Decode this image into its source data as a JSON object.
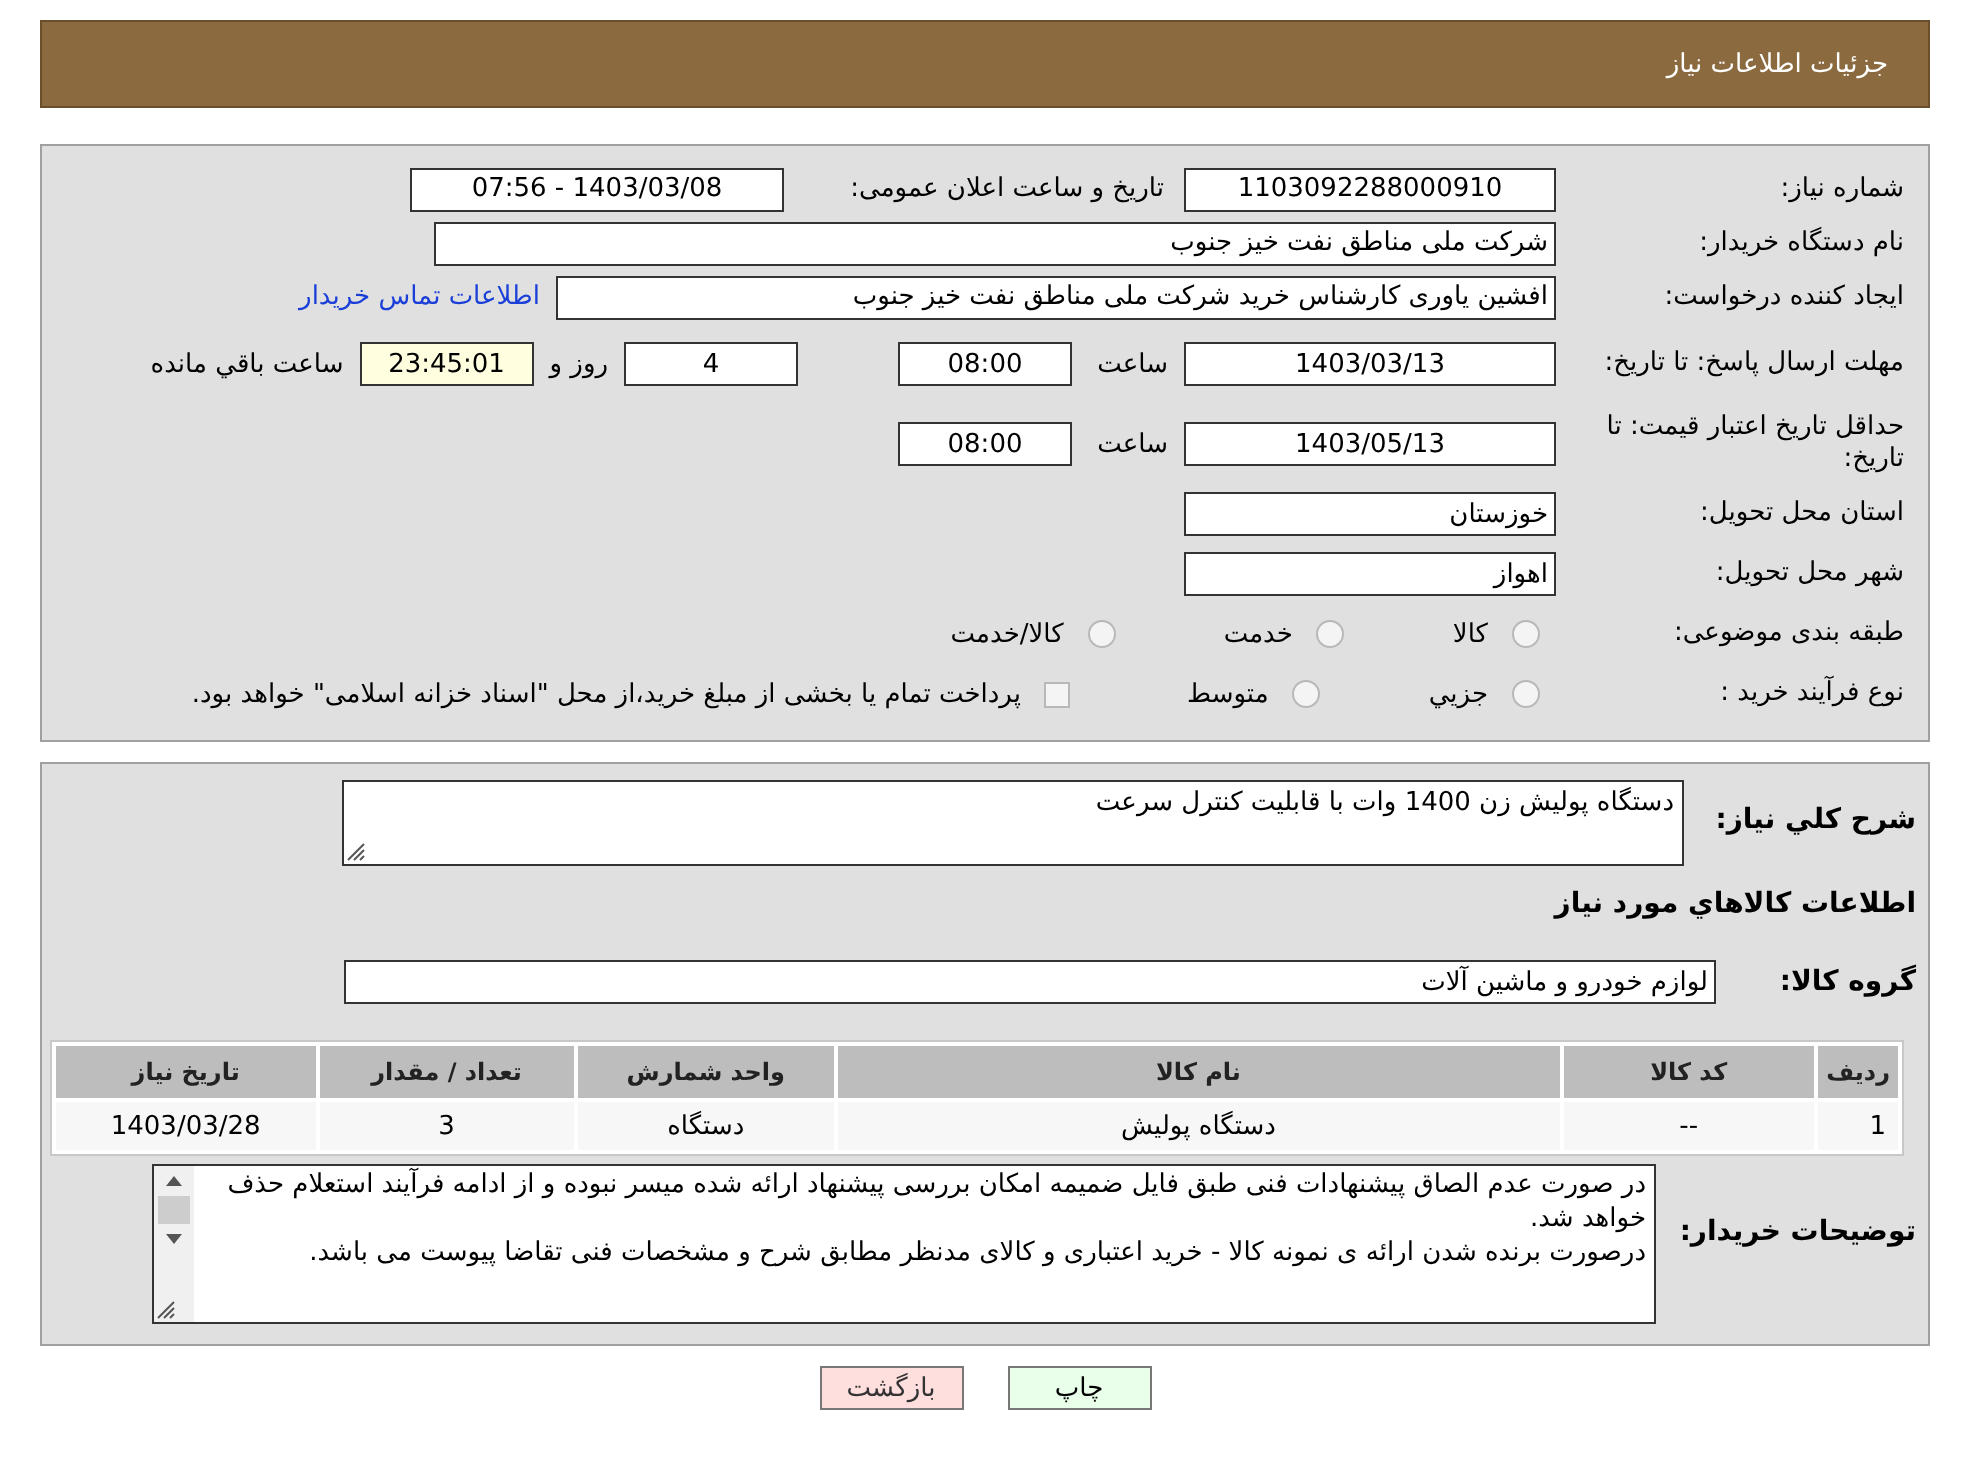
{
  "header": {
    "title": "جزئیات اطلاعات نیاز"
  },
  "details": {
    "need_number": {
      "label": "شماره نياز:",
      "value": "1103092288000910"
    },
    "announce": {
      "label": "تاریخ و ساعت اعلان عمومی:",
      "value": "1403/03/08 - 07:56"
    },
    "buyer": {
      "label": "نام دستگاه خريدار:",
      "value": "شرکت ملی مناطق نفت خیز جنوب"
    },
    "creator": {
      "label": "ايجاد کننده درخواست:",
      "value": "افشین  یاوری  کارشناس خرید  شرکت ملی مناطق نفت خیز جنوب",
      "link": "اطلاعات تماس خريدار"
    },
    "deadline": {
      "label": "مهلت ارسال پاسخ: تا تاریخ:",
      "date": "1403/03/13",
      "time_label": "ساعت",
      "time": "08:00",
      "days": "4",
      "days_label": "روز و",
      "remaining": "23:45:01",
      "remaining_label": "ساعت باقي مانده"
    },
    "validity": {
      "label": "حداقل تاریخ اعتبار قیمت: تا تاریخ:",
      "date": "1403/05/13",
      "time_label": "ساعت",
      "time": "08:00"
    },
    "province": {
      "label": "استان محل تحویل:",
      "value": "خوزستان"
    },
    "city": {
      "label": "شهر محل تحویل:",
      "value": "اهواز"
    },
    "category": {
      "label": "طبقه بندی موضوعی:",
      "options": [
        {
          "label": "کالا",
          "selected": false
        },
        {
          "label": "خدمت",
          "selected": false
        },
        {
          "label": "کالا/خدمت",
          "selected": false
        }
      ]
    },
    "process": {
      "label": "نوع فرآیند خرید :",
      "options": [
        {
          "label": "جزيي",
          "selected": false
        },
        {
          "label": "متوسط",
          "selected": false
        }
      ],
      "treasury": {
        "label": "پرداخت تمام یا بخشی از مبلغ خرید،از محل \"اسناد خزانه اسلامی\" خواهد بود.",
        "checked": false
      }
    }
  },
  "goods": {
    "summary": {
      "label": "شرح کلي نياز:",
      "value": "دستگاه پولیش زن 1400 وات با قابلیت کنترل سرعت"
    },
    "section_title": "اطلاعات کالاهاي مورد نياز",
    "group": {
      "label": "گروه کالا:",
      "value": "لوازم خودرو و ماشین آلات"
    },
    "table": {
      "columns": [
        "رديف",
        "کد کالا",
        "نام کالا",
        "واحد شمارش",
        "تعداد / مقدار",
        "تاريخ نياز"
      ],
      "rows": [
        [
          "1",
          "--",
          "دستگاه پولیش",
          "دستگاه",
          "3",
          "1403/03/28"
        ]
      ]
    },
    "notes": {
      "label": "توضیحات خریدار:",
      "lines": [
        "در صورت عدم الصاق پیشنهادات فنی طبق فایل ضمیمه امکان بررسی پیشنهاد ارائه شده میسر نبوده و از ادامه فرآیند استعلام حذف خواهد شد.",
        "درصورت برنده شدن ارائه ی نمونه کالا - خرید اعتباری و کالای مدنظر مطابق شرح و مشخصات فنی تقاضا پیوست می باشد."
      ]
    }
  },
  "buttons": [
    {
      "label": "چاپ",
      "kind": "print"
    },
    {
      "label": "بازگشت",
      "kind": "back"
    }
  ]
}
